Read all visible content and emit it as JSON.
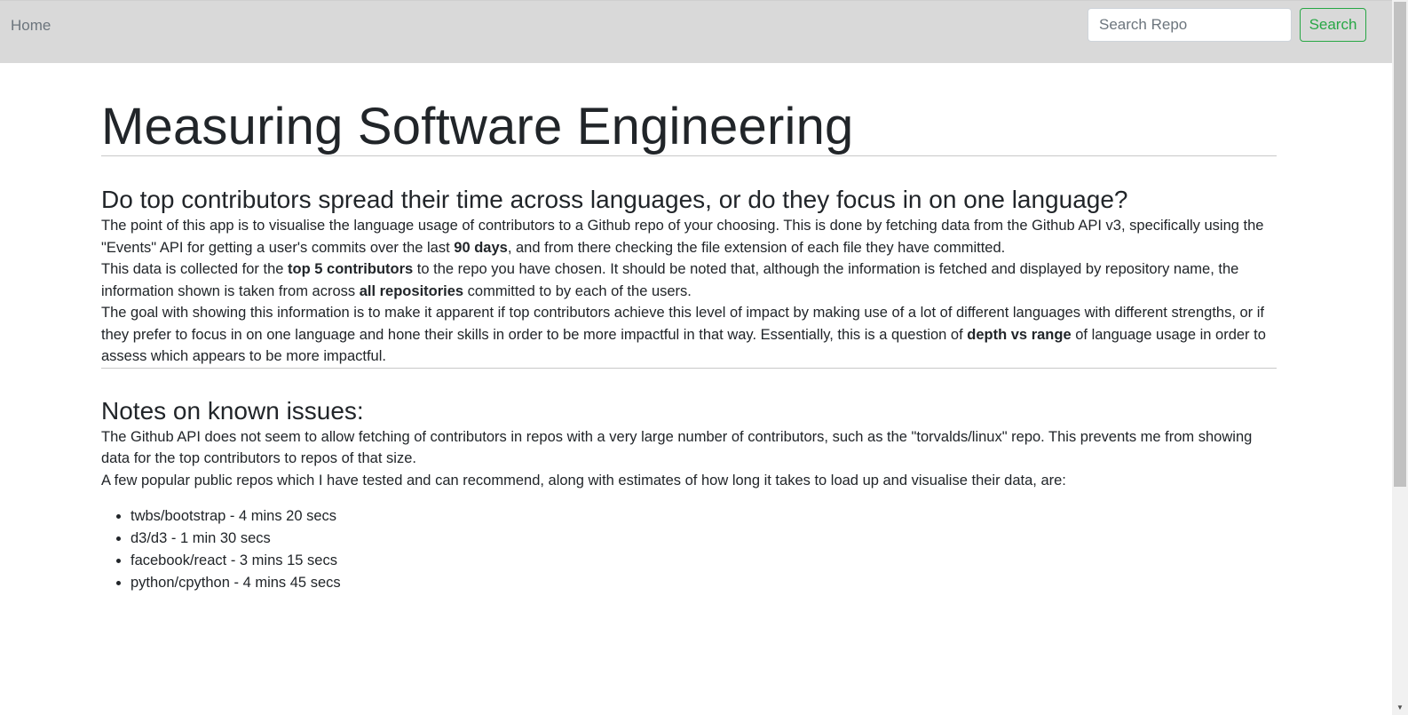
{
  "navbar": {
    "home_label": "Home",
    "search_placeholder": "Search Repo",
    "search_button_label": "Search"
  },
  "main": {
    "title": "Measuring Software Engineering",
    "question_heading": "Do top contributors spread their time across languages, or do they focus in on one language?",
    "intro": {
      "part1": "The point of this app is to visualise the language usage of contributors to a Github repo of your choosing. This is done by fetching data from the Github API v3, specifically using the \"Events\" API for getting a user's commits over the last ",
      "bold1": "90 days",
      "part2": ", and from there checking the file extension of each file they have committed.",
      "part3": "This data is collected for the ",
      "bold2": "top 5 contributors",
      "part4": " to the repo you have chosen. It should be noted that, although the information is fetched and displayed by repository name, the information shown is taken from across ",
      "bold3": "all repositories",
      "part5": " committed to by each of the users."
    },
    "goal": {
      "part1": "The goal with showing this information is to make it apparent if top contributors achieve this level of impact by making use of a lot of different languages with different strengths, or if they prefer to focus in on one language and hone their skills in order to be more impactful in that way. Essentially, this is a question of ",
      "bold1": "depth vs range",
      "part2": " of language usage in order to assess which appears to be more impactful."
    },
    "issues_heading": "Notes on known issues:",
    "issue_text": "The Github API does not seem to allow fetching of contributors in repos with a very large number of contributors, such as the \"torvalds/linux\" repo. This prevents me from showing data for the top contributors to repos of that size.",
    "repos_intro": "A few popular public repos which I have tested and can recommend, along with estimates of how long it takes to load up and visualise their data, are:",
    "repos": [
      "twbs/bootstrap - 4 mins 20 secs",
      "d3/d3 - 1 min 30 secs",
      "facebook/react - 3 mins 15 secs",
      "python/cpython - 4 mins 45 secs"
    ]
  },
  "scrollbar": {
    "up_icon": "triangle-up",
    "down_icon": "triangle-down"
  }
}
